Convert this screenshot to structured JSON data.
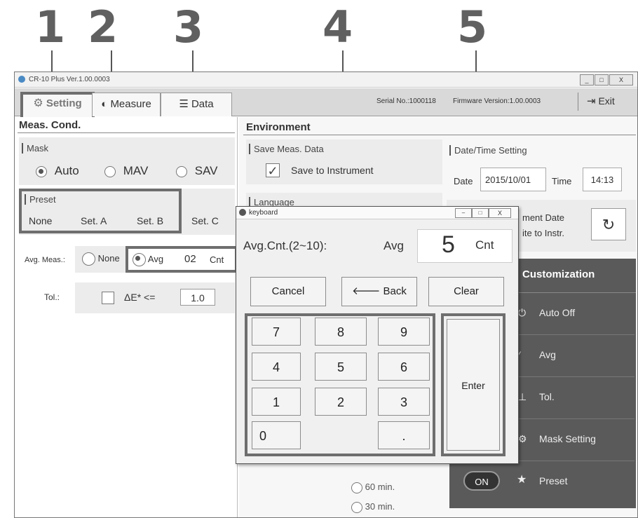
{
  "callouts": [
    "1",
    "2",
    "3",
    "4",
    "5"
  ],
  "window": {
    "title": "CR-10 Plus Ver.1.00.0003",
    "controls": [
      "_",
      "□",
      "X"
    ]
  },
  "tabs": {
    "setting": "Setting",
    "measure": "Measure",
    "data": "Data"
  },
  "header": {
    "serial": "Serial No.:1000118",
    "firmware": "Firmware Version:1.00.0003",
    "exit": "Exit"
  },
  "meas_cond": {
    "title": "Meas. Cond.",
    "mask_label": "Mask",
    "mask_options": [
      "Auto",
      "MAV",
      "SAV"
    ],
    "mask_selected": "Auto",
    "preset_label": "Preset",
    "preset_options": [
      "None",
      "Set. A",
      "Set. B",
      "Set. C"
    ],
    "avg_label": "Avg. Meas.:",
    "avg_none": "None",
    "avg_avg": "Avg",
    "avg_value": "02",
    "avg_unit": "Cnt",
    "tol_label": "Tol.:",
    "tol_expr": "ΔE* <=",
    "tol_value": "1.0"
  },
  "environment": {
    "title": "Environment",
    "save_group": "Save Meas. Data",
    "save_checkbox": "Save to Instrument",
    "language_group": "Language",
    "datetime_group": "Date/Time Setting",
    "date_label": "Date",
    "date_value": "2015/10/01",
    "time_label": "Time",
    "time_value": "14:13",
    "sync_line1": "ment Date",
    "sync_line2": "ite to Instr.",
    "autooff_30": "30 min.",
    "autooff_60": "60 min."
  },
  "customization": {
    "title": "Customization",
    "items": [
      "Auto Off",
      "Avg",
      "Tol.",
      "Mask Setting",
      "Preset"
    ],
    "toggle": "ON"
  },
  "keyboard": {
    "title": "keyboard",
    "label": "Avg.Cnt.(2~10):",
    "field_prefix": "Avg",
    "value": "5",
    "unit": "Cnt",
    "cancel": "Cancel",
    "back": "Back",
    "clear": "Clear",
    "enter": "Enter",
    "keys": [
      "7",
      "8",
      "9",
      "4",
      "5",
      "6",
      "1",
      "2",
      "3",
      "0",
      "."
    ]
  }
}
